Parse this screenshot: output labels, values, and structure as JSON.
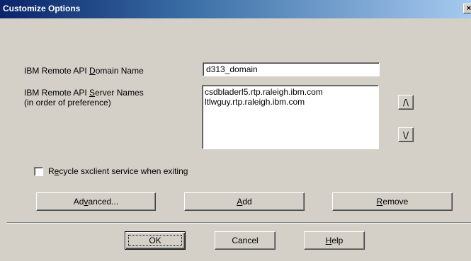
{
  "window": {
    "title": "Customize Options",
    "close_glyph": "×"
  },
  "domain": {
    "label_pre": "IBM Remote API ",
    "label_accel": "D",
    "label_post": "omain Name",
    "value": "d313_domain"
  },
  "servers": {
    "label_pre": "IBM Remote API ",
    "label_accel": "S",
    "label_post": "erver Names",
    "label_line2": "(in order of preference)",
    "items": [
      "csdbladerl5.rtp.raleigh.ibm.com",
      "ltlwguy.rtp.raleigh.ibm.com"
    ],
    "up_glyph": "/\\",
    "down_glyph": "\\/"
  },
  "recycle": {
    "label_pre": "R",
    "label_accel": "e",
    "label_post": "cycle sxclient service when exiting",
    "checked": false
  },
  "actions": {
    "advanced_pre": "Ad",
    "advanced_accel": "v",
    "advanced_post": "anced...",
    "add_accel": "A",
    "add_post": "dd",
    "remove_accel": "R",
    "remove_post": "emove"
  },
  "footer": {
    "ok_label": "OK",
    "cancel_label": "Cancel",
    "help_accel": "H",
    "help_post": "elp"
  }
}
